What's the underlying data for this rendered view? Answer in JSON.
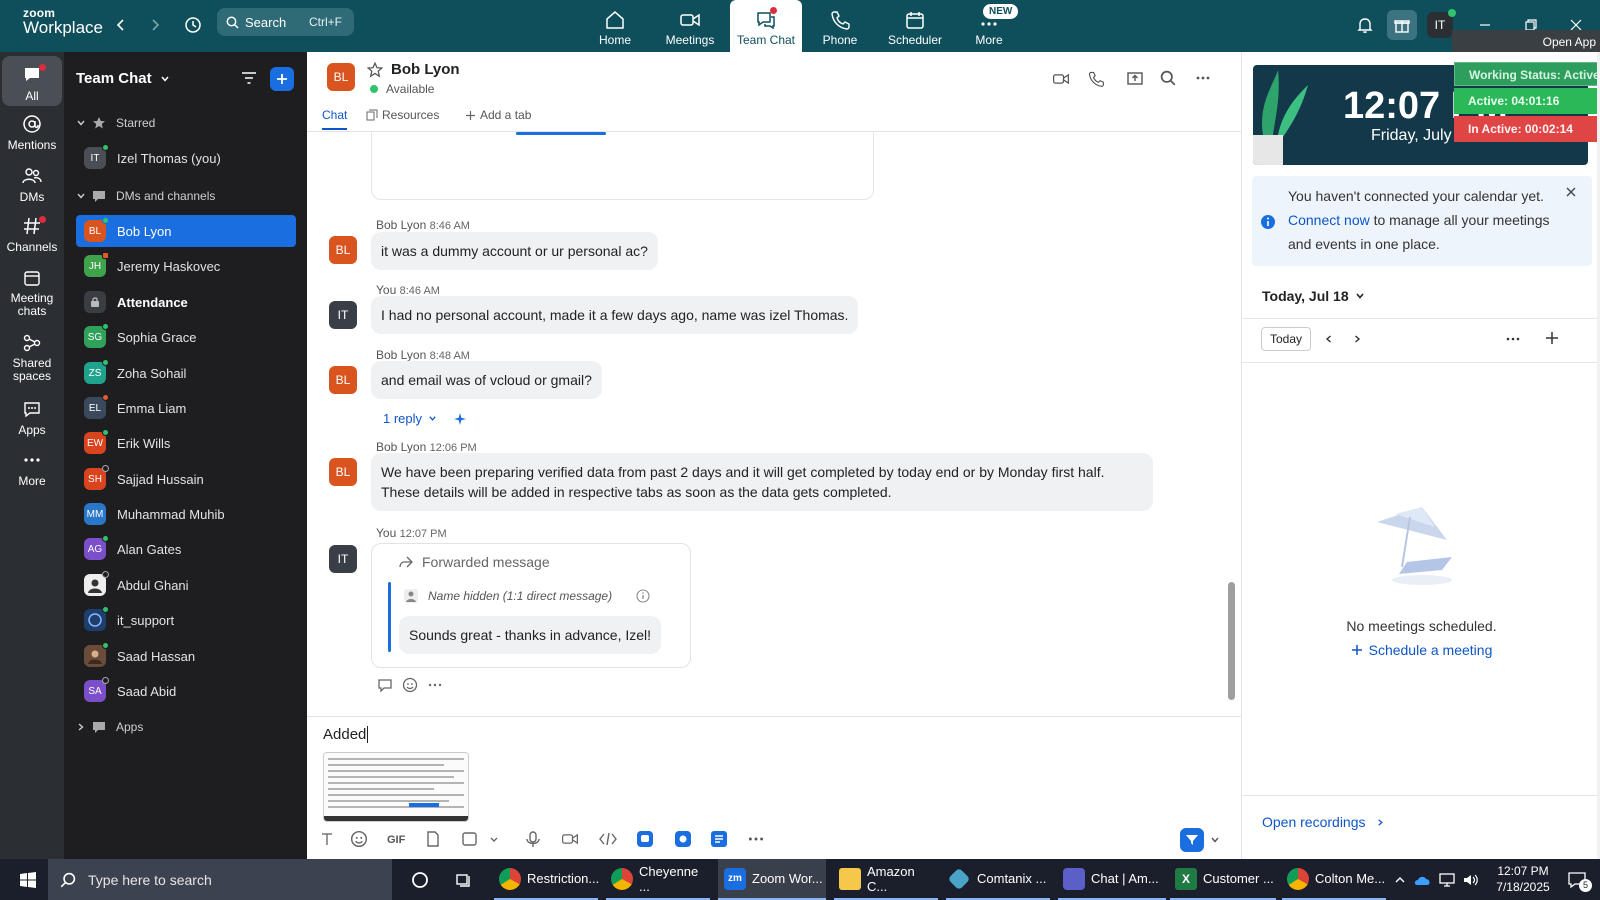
{
  "topbar": {
    "logo_line1": "zoom",
    "logo_line2": "Workplace",
    "search_label": "Search",
    "search_shortcut": "Ctrl+F",
    "nav": [
      {
        "label": "Home"
      },
      {
        "label": "Meetings"
      },
      {
        "label": "Team Chat"
      },
      {
        "label": "Phone"
      },
      {
        "label": "Scheduler"
      },
      {
        "label": "More",
        "badge": "NEW"
      }
    ],
    "avatar_initials": "IT",
    "open_app_label": "Open App"
  },
  "rail": {
    "items": [
      {
        "label": "All"
      },
      {
        "label": "Mentions"
      },
      {
        "label": "DMs"
      },
      {
        "label": "Channels"
      },
      {
        "label": "Meeting chats"
      },
      {
        "label": "Shared spaces"
      },
      {
        "label": "Apps"
      },
      {
        "label": "More"
      }
    ]
  },
  "sidebar": {
    "title": "Team Chat",
    "starred_label": "Starred",
    "starred_item": {
      "initials": "IT",
      "name": "Izel Thomas (you)"
    },
    "dms_label": "DMs and channels",
    "items": [
      {
        "initials": "BL",
        "name": "Bob Lyon"
      },
      {
        "initials": "JH",
        "name": "Jeremy Haskovec"
      },
      {
        "initials": "",
        "name": "Attendance"
      },
      {
        "initials": "SG",
        "name": "Sophia Grace"
      },
      {
        "initials": "ZS",
        "name": "Zoha Sohail"
      },
      {
        "initials": "EL",
        "name": "Emma Liam"
      },
      {
        "initials": "EW",
        "name": "Erik Wills"
      },
      {
        "initials": "SH",
        "name": "Sajjad Hussain"
      },
      {
        "initials": "MM",
        "name": "Muhammad Muhib"
      },
      {
        "initials": "AG",
        "name": "Alan Gates"
      },
      {
        "initials": "",
        "name": "Abdul Ghani"
      },
      {
        "initials": "",
        "name": "it_support"
      },
      {
        "initials": "",
        "name": "Saad Hassan"
      },
      {
        "initials": "SA",
        "name": "Saad Abid"
      }
    ],
    "apps_label": "Apps"
  },
  "chat": {
    "contact_initials": "BL",
    "contact_name": "Bob Lyon",
    "contact_status": "Available",
    "tabs": [
      {
        "label": "Chat"
      },
      {
        "label": "Resources"
      },
      {
        "label": "Add a tab"
      }
    ],
    "messages": [
      {
        "sender": "Bob Lyon",
        "time": "8:46 AM",
        "initials": "BL",
        "text": "it was a dummy account or ur personal ac?"
      },
      {
        "sender": "You",
        "time": "8:46 AM",
        "initials": "IT",
        "text": "I had no personal account, made it a few days ago, name was izel Thomas."
      },
      {
        "sender": "Bob Lyon",
        "time": "8:48 AM",
        "initials": "BL",
        "text": "and email was of vcloud or gmail?",
        "reply": "1 reply"
      },
      {
        "sender": "Bob Lyon",
        "time": "12:06 PM",
        "initials": "BL",
        "text": "We have been preparing verified data from past 2 days and it will get completed by today end or by Monday first half. These details will be added in respective tabs as soon as the data gets completed."
      },
      {
        "sender": "You",
        "time": "12:07 PM",
        "initials": "IT",
        "forwarded_label": "Forwarded message",
        "forwarded_source": "Name hidden (1:1 direct message)",
        "forwarded_text": "Sounds great - thanks in advance, Izel!"
      }
    ],
    "composer_text": "Added",
    "toolbar_gif": "GIF"
  },
  "right": {
    "clock_time": "12:07 PM",
    "clock_date": "Friday, July 18",
    "working_status": "Working Status: Active",
    "active_time": "Active: 04:01:16",
    "inactive_time": "In Active: 00:02:14",
    "notice_pre": "You haven't connected your calendar yet.",
    "notice_link": "Connect now",
    "notice_post": "to manage all your meetings and events in one place.",
    "date_label": "Today, Jul 18",
    "today_button": "Today",
    "no_meetings": "No meetings scheduled.",
    "schedule_link": "Schedule a meeting",
    "open_recordings": "Open recordings"
  },
  "taskbar": {
    "search_placeholder": "Type here to search",
    "apps": [
      {
        "label": "Restriction..."
      },
      {
        "label": "Cheyenne ..."
      },
      {
        "label": "Zoom Wor..."
      },
      {
        "label": "Amazon C..."
      },
      {
        "label": "Comtanix ..."
      },
      {
        "label": "Chat | Am..."
      },
      {
        "label": "Customer ..."
      },
      {
        "label": "Colton Me..."
      }
    ],
    "time": "12:07 PM",
    "date": "7/18/2025",
    "notification_count": "5"
  }
}
